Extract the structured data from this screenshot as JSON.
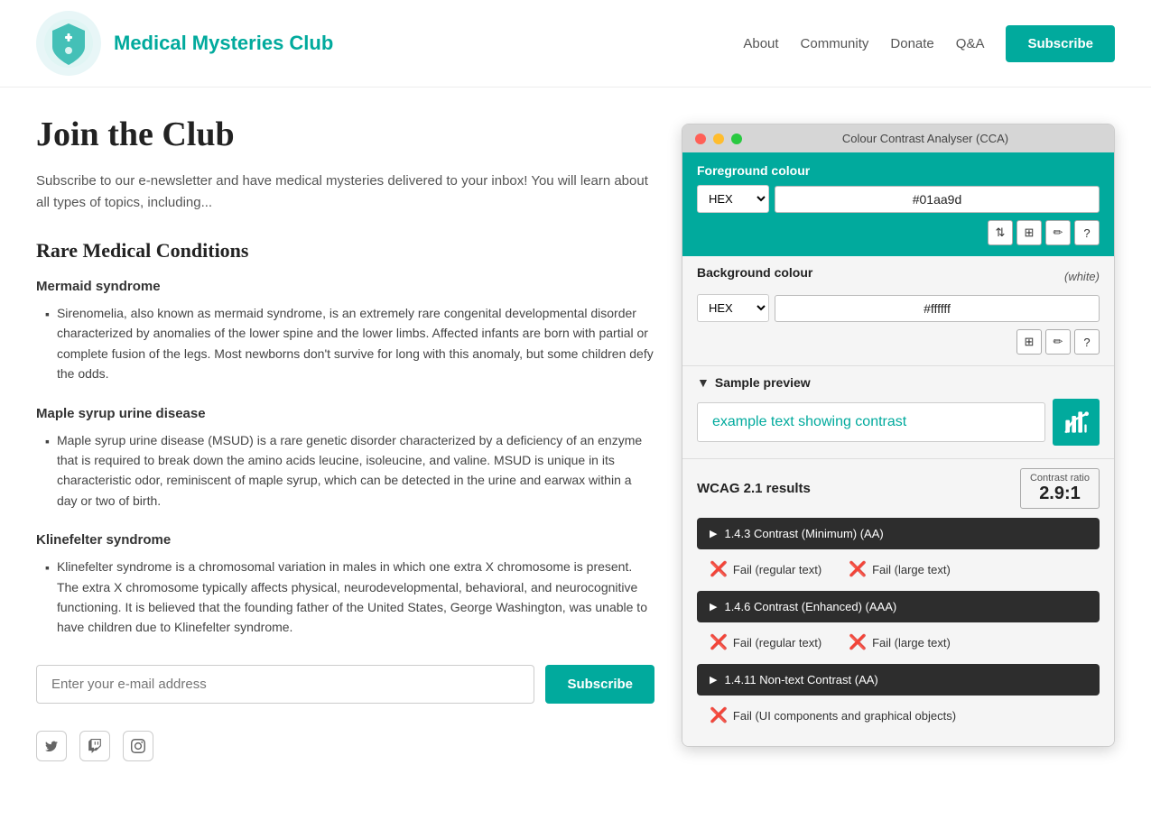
{
  "header": {
    "site_title": "Medical Mysteries Club",
    "nav": [
      {
        "label": "About",
        "href": "#"
      },
      {
        "label": "Community",
        "href": "#"
      },
      {
        "label": "Donate",
        "href": "#"
      },
      {
        "label": "Q&A",
        "href": "#"
      }
    ],
    "subscribe_label": "Subscribe"
  },
  "main": {
    "page_title": "Join the Club",
    "intro": "Subscribe to our e-newsletter and have medical mysteries delivered to your inbox! You will learn about all types of topics, including...",
    "section_title": "Rare Medical Conditions",
    "conditions": [
      {
        "title": "Mermaid syndrome",
        "description": "Sirenomelia, also known as mermaid syndrome, is an extremely rare congenital developmental disorder characterized by anomalies of the lower spine and the lower limbs. Affected infants are born with partial or complete fusion of the legs. Most newborns don't survive for long with this anomaly, but some children defy the odds."
      },
      {
        "title": "Maple syrup urine disease",
        "description": "Maple syrup urine disease (MSUD) is a rare genetic disorder characterized by a deficiency of an enzyme that is required to break down the amino acids leucine, isoleucine, and valine. MSUD is unique in its characteristic odor, reminiscent of maple syrup, which can be detected in the urine and earwax within a day or two of birth."
      },
      {
        "title": "Klinefelter syndrome",
        "description": "Klinefelter syndrome is a chromosomal variation in males in which one extra X chromosome is present. The extra X chromosome typically affects physical, neurodevelopmental, behavioral, and neurocognitive functioning. It is believed that the founding father of the United States, George Washington, was unable to have children due to Klinefelter syndrome."
      }
    ],
    "email_placeholder": "Enter your e-mail address",
    "subscribe_btn_label": "Subscribe"
  },
  "cca": {
    "title": "Colour Contrast Analyser (CCA)",
    "foreground_label": "Foreground colour",
    "fg_type": "HEX",
    "fg_value": "#01aa9d",
    "background_label": "Background colour",
    "bg_white_note": "(white)",
    "bg_type": "HEX",
    "bg_value": "#ffffff",
    "sample_preview_label": "Sample preview",
    "preview_text": "example text showing contrast",
    "wcag_label": "WCAG 2.1 results",
    "contrast_ratio_label": "Contrast ratio",
    "contrast_ratio_value": "2.9:1",
    "wcag_items": [
      {
        "label": "1.4.3 Contrast (Minimum) (AA)",
        "fail_regular": "Fail (regular text)",
        "fail_large": "Fail (large text)"
      },
      {
        "label": "1.4.6 Contrast (Enhanced) (AAA)",
        "fail_regular": "Fail (regular text)",
        "fail_large": "Fail (large text)"
      },
      {
        "label": "1.4.11 Non-text Contrast (AA)",
        "fail_regular": "Fail (UI components and graphical objects)",
        "fail_large": null
      }
    ],
    "tools": {
      "swap": "⇅",
      "sliders": "⊞",
      "eyedropper": "✏",
      "help": "?"
    }
  }
}
